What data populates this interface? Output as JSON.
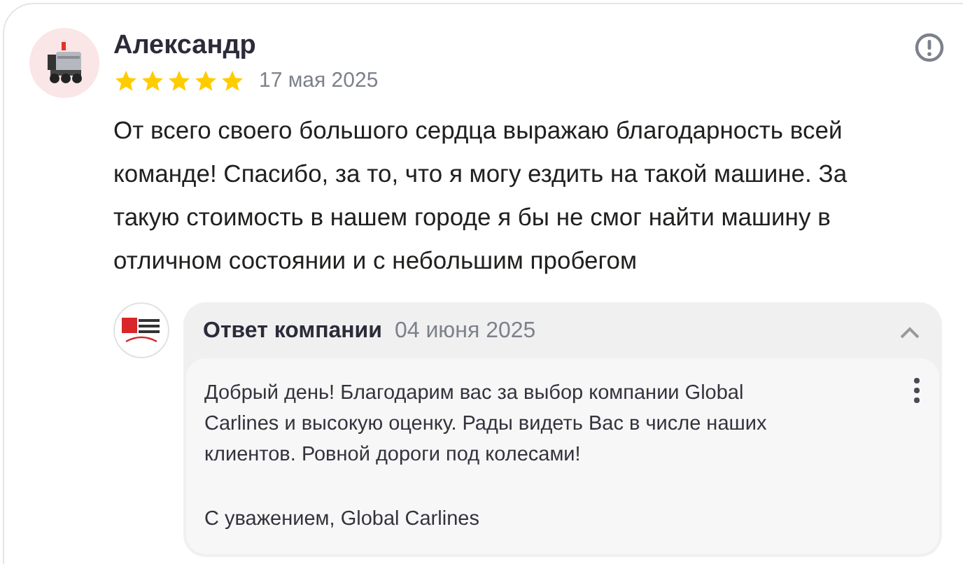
{
  "review": {
    "author": "Александр",
    "stars": 5,
    "date": "17 мая 2025",
    "text": "От всего своего большого сердца выражаю благодарность всей команде! Спасибо, за то, что я могу ездить на такой машине. За такую стоимость в нашем городе я бы не смог найти машину в отличном состоянии и с небольшим пробегом"
  },
  "reply": {
    "title": "Ответ компании",
    "date": "04 июня 2025",
    "expanded": true,
    "paragraphs": [
      "Добрый день! Благодарим вас за выбор компании Global Carlines и высокую оценку. Рады видеть Вас в числе наших клиентов. Ровной дороги под колесами!",
      "С уважением, Global Carlines"
    ]
  }
}
